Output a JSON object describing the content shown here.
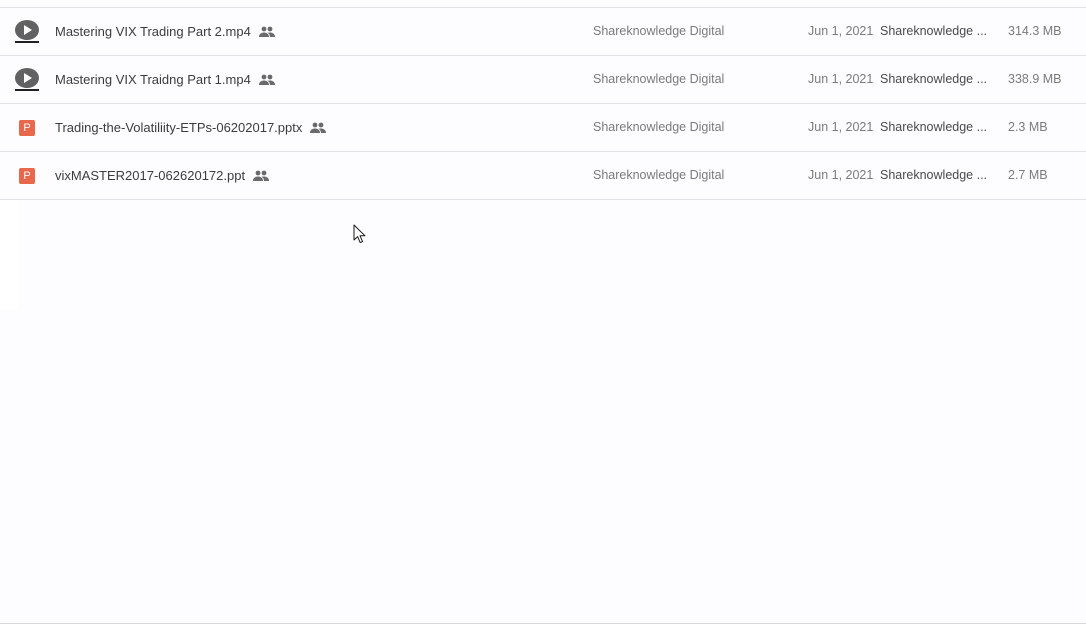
{
  "file_list": {
    "rows": [
      {
        "name": "Mastering VIX Trading Part 2.mp4",
        "type_icon": "video-icon",
        "shared_icon": "people-icon",
        "owner": "Shareknowledge Digital",
        "date": "Jun 1, 2021",
        "modified_by": "Shareknowledge ...",
        "size": "314.3 MB"
      },
      {
        "name": "Mastering VIX Traidng Part 1.mp4",
        "type_icon": "video-icon",
        "shared_icon": "people-icon",
        "owner": "Shareknowledge Digital",
        "date": "Jun 1, 2021",
        "modified_by": "Shareknowledge ...",
        "size": "338.9 MB"
      },
      {
        "name": "Trading-the-Volatiliity-ETPs-06202017.pptx",
        "type_icon": "slides-icon",
        "type_letter": "P",
        "shared_icon": "people-icon",
        "owner": "Shareknowledge Digital",
        "date": "Jun 1, 2021",
        "modified_by": "Shareknowledge ...",
        "size": "2.3 MB"
      },
      {
        "name": "vixMASTER2017-062620172.ppt",
        "type_icon": "slides-icon",
        "type_letter": "P",
        "shared_icon": "people-icon",
        "owner": "Shareknowledge Digital",
        "date": "Jun 1, 2021",
        "modified_by": "Shareknowledge ...",
        "size": "2.7 MB"
      }
    ]
  },
  "colors": {
    "background": "#fdfcfe",
    "divider": "#e2e2e2",
    "video_icon": "#616161",
    "slides_icon": "#e9674a",
    "primary_text": "#3c3c3c",
    "secondary_text": "#7b7b7b"
  }
}
